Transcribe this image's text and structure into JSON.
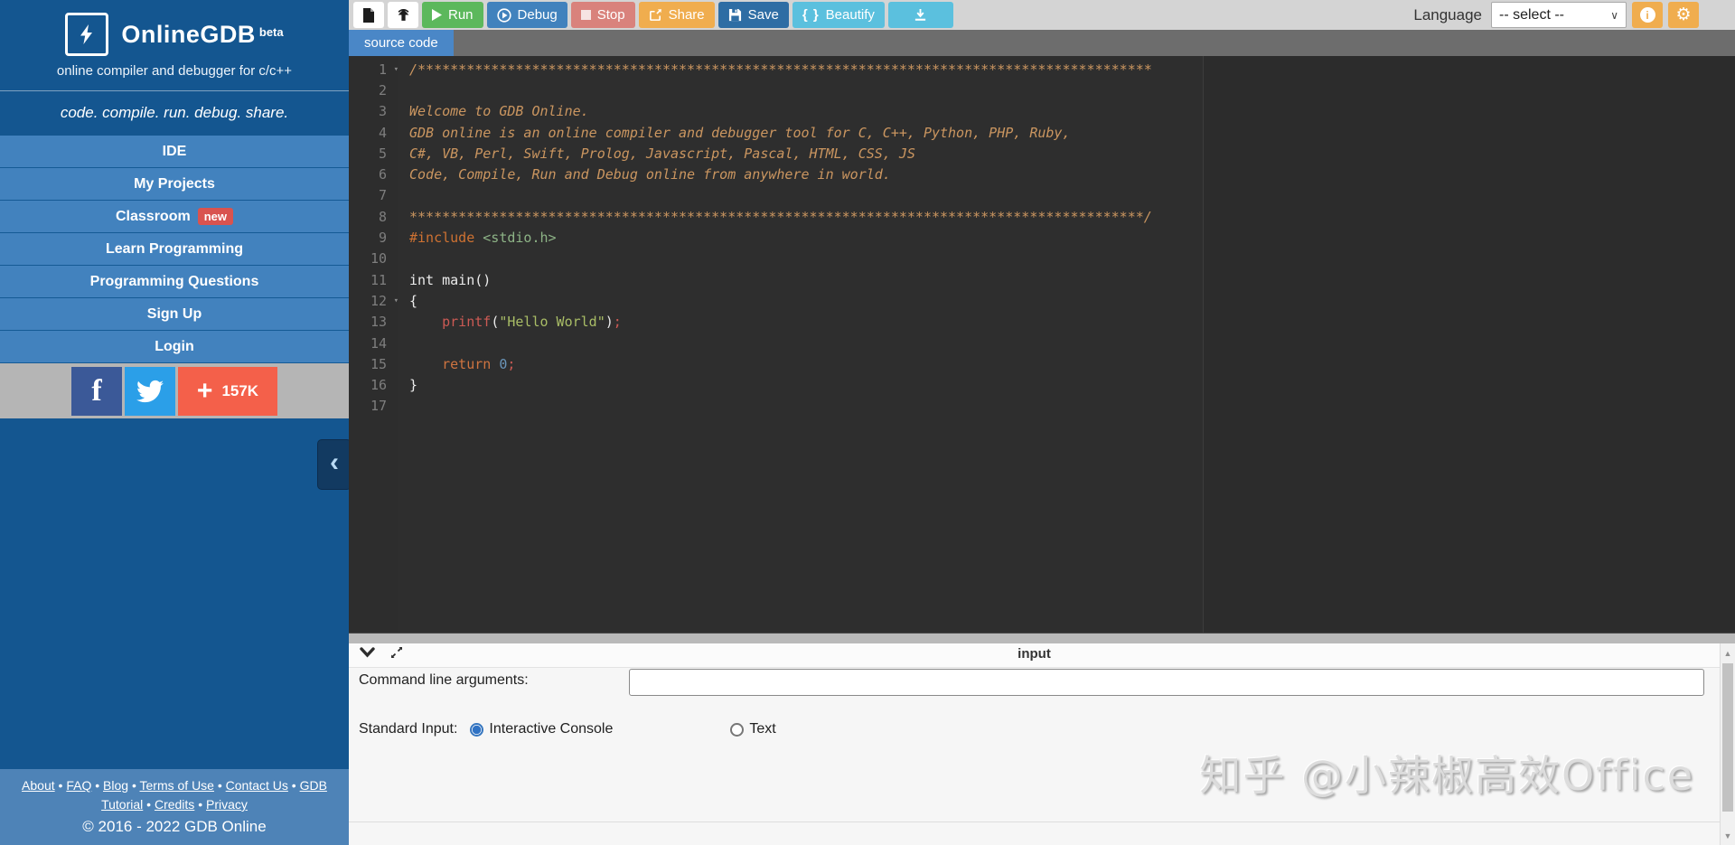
{
  "sidebar": {
    "brand": {
      "name": "OnlineGDB",
      "beta": "beta",
      "subtitle": "online compiler and debugger for c/c++",
      "tagline": "code. compile. run. debug. share."
    },
    "menu": [
      {
        "label": "IDE"
      },
      {
        "label": "My Projects"
      },
      {
        "label": "Classroom",
        "badge": "new"
      },
      {
        "label": "Learn Programming"
      },
      {
        "label": "Programming Questions"
      },
      {
        "label": "Sign Up"
      },
      {
        "label": "Login"
      }
    ],
    "share_count": "157K",
    "footer": {
      "links": [
        "About",
        "FAQ",
        "Blog",
        "Terms of Use",
        "Contact Us",
        "GDB Tutorial",
        "Credits",
        "Privacy"
      ],
      "copyright": "© 2016 - 2022 GDB Online"
    }
  },
  "toolbar": {
    "run": "Run",
    "debug": "Debug",
    "stop": "Stop",
    "share": "Share",
    "save": "Save",
    "beautify": "Beautify",
    "beautify_icon": "{ }",
    "language_label": "Language",
    "language_value": "-- select --"
  },
  "editor": {
    "tab": "source code",
    "lines": [
      {
        "n": 1,
        "fold": true,
        "seg": [
          [
            "c",
            "/******************************************************************************************"
          ]
        ]
      },
      {
        "n": 2,
        "seg": []
      },
      {
        "n": 3,
        "seg": [
          [
            "c",
            "Welcome to GDB Online."
          ]
        ]
      },
      {
        "n": 4,
        "seg": [
          [
            "c",
            "GDB online is an online compiler and debugger tool for C, C++, Python, PHP, Ruby,"
          ]
        ]
      },
      {
        "n": 5,
        "seg": [
          [
            "c",
            "C#, VB, Perl, Swift, Prolog, Javascript, Pascal, HTML, CSS, JS"
          ]
        ]
      },
      {
        "n": 6,
        "seg": [
          [
            "c",
            "Code, Compile, Run and Debug online from anywhere in world."
          ]
        ]
      },
      {
        "n": 7,
        "seg": []
      },
      {
        "n": 8,
        "seg": [
          [
            "c",
            "******************************************************************************************/"
          ]
        ]
      },
      {
        "n": 9,
        "seg": [
          [
            "kw",
            "#include"
          ],
          [
            "pl",
            " "
          ],
          [
            "inc",
            "<stdio.h>"
          ]
        ]
      },
      {
        "n": 10,
        "seg": []
      },
      {
        "n": 11,
        "seg": [
          [
            "pl",
            "int main()"
          ]
        ]
      },
      {
        "n": 12,
        "fold": true,
        "seg": [
          [
            "pl",
            "{"
          ]
        ]
      },
      {
        "n": 13,
        "seg": [
          [
            "pl",
            "    "
          ],
          [
            "fn",
            "printf"
          ],
          [
            "pl",
            "("
          ],
          [
            "str",
            "\"Hello World\""
          ],
          [
            "pl",
            ")"
          ],
          [
            "red",
            ";"
          ]
        ]
      },
      {
        "n": 14,
        "seg": []
      },
      {
        "n": 15,
        "seg": [
          [
            "pl",
            "    "
          ],
          [
            "kw2",
            "return"
          ],
          [
            "pl",
            " "
          ],
          [
            "num",
            "0"
          ],
          [
            "red",
            ";"
          ]
        ]
      },
      {
        "n": 16,
        "seg": [
          [
            "pl",
            "}"
          ]
        ]
      },
      {
        "n": 17,
        "seg": []
      }
    ]
  },
  "input_panel": {
    "title": "input",
    "cmd_label": "Command line arguments:",
    "cmd_value": "",
    "stdin_label": "Standard Input:",
    "radio_interactive": "Interactive Console",
    "radio_text": "Text"
  },
  "watermark": "知乎 @小辣椒高效Office",
  "colors": {
    "sidebar_deep": "#145690",
    "menu_blue": "#4282be",
    "footer_blue": "#4e83b7",
    "run_green": "#5cb85c",
    "debug_blue": "#4182bd",
    "stop_red": "#d9827c",
    "share_orange": "#f0ad4e",
    "save_blue": "#2e6da4",
    "beautify_cyan": "#5bc0de",
    "badge_red": "#d9534f",
    "tab_blue": "#4a87c7",
    "editor_bg": "#2e2e2e",
    "facebook": "#3b5998",
    "twitter": "#2b9fe8",
    "addthis": "#f4604a"
  }
}
